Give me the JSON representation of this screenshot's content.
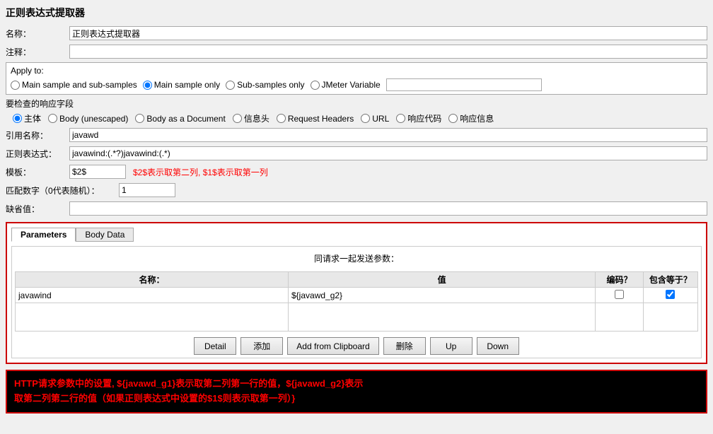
{
  "page": {
    "title": "正则表达式提取器"
  },
  "form": {
    "name_label": "名称：",
    "name_value": "正则表达式提取器",
    "comment_label": "注释：",
    "comment_value": "",
    "apply_to": {
      "title": "Apply to:",
      "options": [
        {
          "id": "main-sub",
          "label": "Main sample and sub-samples",
          "checked": false
        },
        {
          "id": "main-only",
          "label": "Main sample only",
          "checked": true
        },
        {
          "id": "sub-only",
          "label": "Sub-samples only",
          "checked": false
        },
        {
          "id": "jmeter-var",
          "label": "JMeter Variable",
          "checked": false
        }
      ],
      "jmeter_var_value": ""
    },
    "response_field_label": "要检查的响应字段",
    "response_fields": [
      {
        "id": "body",
        "label": "主体",
        "checked": true
      },
      {
        "id": "body-unescaped",
        "label": "Body (unescaped)",
        "checked": false
      },
      {
        "id": "body-doc",
        "label": "Body as a Document",
        "checked": false
      },
      {
        "id": "info-header",
        "label": "信息头",
        "checked": false
      },
      {
        "id": "req-headers",
        "label": "Request Headers",
        "checked": false
      },
      {
        "id": "url",
        "label": "URL",
        "checked": false
      },
      {
        "id": "resp-code",
        "label": "响应代码",
        "checked": false
      },
      {
        "id": "resp-msg",
        "label": "响应信息",
        "checked": false
      }
    ],
    "ref_name_label": "引用名称：",
    "ref_name_value": "javawd",
    "regex_label": "正则表达式：",
    "regex_value": "javawind:(.*?)javawind:(.*)",
    "template_label": "模板：",
    "template_value": "$2$",
    "template_annotation": "$2$表示取第二列, $1$表示取第一列",
    "match_no_label": "匹配数字（0代表随机）：",
    "match_no_value": "1",
    "default_label": "缺省值：",
    "default_value": ""
  },
  "params_panel": {
    "tabs": [
      {
        "label": "Parameters",
        "active": true
      },
      {
        "label": "Body Data",
        "active": false
      }
    ],
    "send_label": "同请求一起发送参数：",
    "table": {
      "headers": [
        "名称：",
        "值",
        "编码？",
        "包含等于？"
      ],
      "rows": [
        {
          "name": "javawind",
          "value": "${javawd_g2}",
          "encode": false,
          "include": true
        }
      ]
    },
    "buttons": [
      {
        "label": "Detail",
        "name": "detail-button"
      },
      {
        "label": "添加",
        "name": "add-button"
      },
      {
        "label": "Add from Clipboard",
        "name": "add-clipboard-button"
      },
      {
        "label": "删除",
        "name": "delete-button"
      },
      {
        "label": "Up",
        "name": "up-button"
      },
      {
        "label": "Down",
        "name": "down-button"
      }
    ]
  },
  "info_box": {
    "text_line1": "HTTP请求参数中的设置, ${javawd_g1}表示取第二列第一行的值，${javawd_g2}表示",
    "text_line2": "取第二列第二行的值（如果正则表达式中设置的$1$则表示取第一列）}"
  }
}
